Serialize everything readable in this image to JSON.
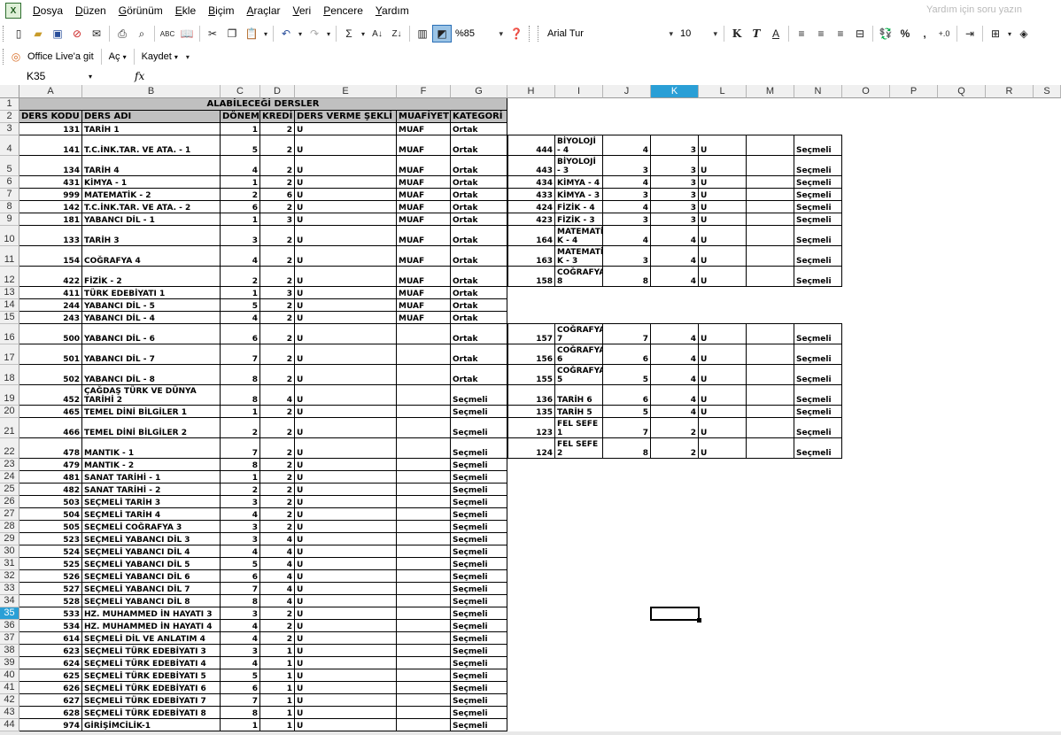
{
  "menu": {
    "items": [
      {
        "u": "D",
        "rest": "osya"
      },
      {
        "u": "D",
        "rest": "üzen"
      },
      {
        "u": "G",
        "rest": "örünüm"
      },
      {
        "u": "E",
        "rest": "kle"
      },
      {
        "u": "B",
        "rest": "içim"
      },
      {
        "u": "A",
        "rest": "raçlar"
      },
      {
        "u": "V",
        "rest": "eri"
      },
      {
        "u": "P",
        "rest": "encere"
      },
      {
        "u": "Y",
        "rest": "ardım"
      }
    ],
    "help_placeholder": "Yardım için soru yazın"
  },
  "toolbar": {
    "zoom": "%85",
    "font": "Arial Tur",
    "size": "10",
    "bold": "K",
    "italic": "T",
    "underline": "A",
    "percent": "%",
    "comma": ","
  },
  "toolbar2": {
    "office_live": "Office Live'a git",
    "open": "Aç",
    "save": "Kaydet"
  },
  "formula": {
    "namebox": "K35",
    "fx": "fx",
    "content": ""
  },
  "sheet": {
    "selected_cell": "K35",
    "columns": [
      "A",
      "B",
      "C",
      "D",
      "E",
      "F",
      "G",
      "H",
      "I",
      "J",
      "K",
      "L",
      "M",
      "N",
      "O",
      "P",
      "Q",
      "R",
      "S"
    ],
    "title": "ALABİLECEĞİ DERSLER",
    "headers": [
      "DERS KODU",
      "DERS ADI",
      "DÖNEM",
      "KREDİ",
      "DERS VERME ŞEKLİ",
      "MUAFİYET",
      "KATEGORİ"
    ],
    "rows": [
      {
        "r": "3",
        "a": "131",
        "b": "TARİH 1",
        "c": "1",
        "d": "2",
        "e": "U",
        "f": "MUAF",
        "g": "Ortak"
      },
      {
        "r": "4",
        "a": "141",
        "b": "T.C.İNK.TAR. VE ATA. - 1",
        "c": "5",
        "d": "2",
        "e": "U",
        "f": "MUAF",
        "g": "Ortak",
        "h": "444",
        "i": "BİYOLOJİ - 4",
        "j": "4",
        "k": "3",
        "l": "U",
        "n": "Seçmeli"
      },
      {
        "r": "5",
        "a": "134",
        "b": "TARİH 4",
        "c": "4",
        "d": "2",
        "e": "U",
        "f": "MUAF",
        "g": "Ortak",
        "h": "443",
        "i": "BİYOLOJİ - 3",
        "j": "3",
        "k": "3",
        "l": "U",
        "n": "Seçmeli"
      },
      {
        "r": "6",
        "a": "431",
        "b": "KİMYA - 1",
        "c": "1",
        "d": "2",
        "e": "U",
        "f": "MUAF",
        "g": "Ortak",
        "h": "434",
        "i": "KİMYA - 4",
        "j": "4",
        "k": "3",
        "l": "U",
        "n": "Seçmeli"
      },
      {
        "r": "7",
        "a": "999",
        "b": "MATEMATİK - 2",
        "c": "2",
        "d": "6",
        "e": "U",
        "f": "MUAF",
        "g": "Ortak",
        "h": "433",
        "i": "KİMYA - 3",
        "j": "3",
        "k": "3",
        "l": "U",
        "n": "Seçmeli"
      },
      {
        "r": "8",
        "a": "142",
        "b": "T.C.İNK.TAR. VE ATA. - 2",
        "c": "6",
        "d": "2",
        "e": "U",
        "f": "MUAF",
        "g": "Ortak",
        "h": "424",
        "i": "FİZİK - 4",
        "j": "4",
        "k": "3",
        "l": "U",
        "n": "Seçmeli"
      },
      {
        "r": "9",
        "a": "181",
        "b": "YABANCI DİL - 1",
        "c": "1",
        "d": "3",
        "e": "U",
        "f": "MUAF",
        "g": "Ortak",
        "h": "423",
        "i": "FİZİK - 3",
        "j": "3",
        "k": "3",
        "l": "U",
        "n": "Seçmeli"
      },
      {
        "r": "10",
        "a": "133",
        "b": "TARİH 3",
        "c": "3",
        "d": "2",
        "e": "U",
        "f": "MUAF",
        "g": "Ortak",
        "h": "164",
        "i": "MATEMATİ K - 4",
        "j": "4",
        "k": "4",
        "l": "U",
        "n": "Seçmeli"
      },
      {
        "r": "11",
        "a": "154",
        "b": "COĞRAFYA 4",
        "c": "4",
        "d": "2",
        "e": "U",
        "f": "MUAF",
        "g": "Ortak",
        "h": "163",
        "i": "MATEMATİ K - 3",
        "j": "3",
        "k": "4",
        "l": "U",
        "n": "Seçmeli"
      },
      {
        "r": "12",
        "a": "422",
        "b": "FİZİK - 2",
        "c": "2",
        "d": "2",
        "e": "U",
        "f": "MUAF",
        "g": "Ortak",
        "h": "158",
        "i": "COĞRAFYA 8",
        "j": "8",
        "k": "4",
        "l": "U",
        "n": "Seçmeli"
      },
      {
        "r": "13",
        "a": "411",
        "b": "TÜRK EDEBİYATI 1",
        "c": "1",
        "d": "3",
        "e": "U",
        "f": "MUAF",
        "g": "Ortak"
      },
      {
        "r": "14",
        "a": "244",
        "b": "YABANCI DİL - 5",
        "c": "5",
        "d": "2",
        "e": "U",
        "f": "MUAF",
        "g": "Ortak"
      },
      {
        "r": "15",
        "a": "243",
        "b": "YABANCI DİL - 4",
        "c": "4",
        "d": "2",
        "e": "U",
        "f": "MUAF",
        "g": "Ortak"
      },
      {
        "r": "16",
        "a": "500",
        "b": "YABANCI DİL - 6",
        "c": "6",
        "d": "2",
        "e": "U",
        "f": "",
        "g": "Ortak",
        "h": "157",
        "i": "COĞRAFYA 7",
        "j": "7",
        "k": "4",
        "l": "U",
        "n": "Seçmeli"
      },
      {
        "r": "17",
        "a": "501",
        "b": "YABANCI DİL - 7",
        "c": "7",
        "d": "2",
        "e": "U",
        "f": "",
        "g": "Ortak",
        "h": "156",
        "i": "COĞRAFYA 6",
        "j": "6",
        "k": "4",
        "l": "U",
        "n": "Seçmeli"
      },
      {
        "r": "18",
        "a": "502",
        "b": "YABANCI DİL - 8",
        "c": "8",
        "d": "2",
        "e": "U",
        "f": "",
        "g": "Ortak",
        "h": "155",
        "i": "COĞRAFYA 5",
        "j": "5",
        "k": "4",
        "l": "U",
        "n": "Seçmeli"
      },
      {
        "r": "19",
        "a": "452",
        "b": "ÇAĞDAŞ TÜRK VE DÜNYA TARİHİ 2",
        "c": "8",
        "d": "4",
        "e": "U",
        "f": "",
        "g": "Seçmeli",
        "h": "136",
        "i": "TARİH 6",
        "j": "6",
        "k": "4",
        "l": "U",
        "n": "Seçmeli"
      },
      {
        "r": "20",
        "a": "465",
        "b": "TEMEL DİNİ BİLGİLER 1",
        "c": "1",
        "d": "2",
        "e": "U",
        "f": "",
        "g": "Seçmeli",
        "h": "135",
        "i": "TARİH 5",
        "j": "5",
        "k": "4",
        "l": "U",
        "n": "Seçmeli"
      },
      {
        "r": "21",
        "a": "466",
        "b": "TEMEL DİNİ BİLGİLER 2",
        "c": "2",
        "d": "2",
        "e": "U",
        "f": "",
        "g": "Seçmeli",
        "h": "123",
        "i": "FEL SEFE 1",
        "j": "7",
        "k": "2",
        "l": "U",
        "n": "Seçmeli"
      },
      {
        "r": "22",
        "a": "478",
        "b": "MANTIK - 1",
        "c": "7",
        "d": "2",
        "e": "U",
        "f": "",
        "g": "Seçmeli",
        "h": "124",
        "i": "FEL SEFE 2",
        "j": "8",
        "k": "2",
        "l": "U",
        "n": "Seçmeli"
      },
      {
        "r": "23",
        "a": "479",
        "b": "MANTIK - 2",
        "c": "8",
        "d": "2",
        "e": "U",
        "f": "",
        "g": "Seçmeli"
      },
      {
        "r": "24",
        "a": "481",
        "b": "SANAT TARİHİ - 1",
        "c": "1",
        "d": "2",
        "e": "U",
        "f": "",
        "g": "Seçmeli"
      },
      {
        "r": "25",
        "a": "482",
        "b": "SANAT TARİHİ - 2",
        "c": "2",
        "d": "2",
        "e": "U",
        "f": "",
        "g": "Seçmeli"
      },
      {
        "r": "26",
        "a": "503",
        "b": "SEÇMELİ TARİH 3",
        "c": "3",
        "d": "2",
        "e": "U",
        "f": "",
        "g": "Seçmeli"
      },
      {
        "r": "27",
        "a": "504",
        "b": "SEÇMELİ TARİH 4",
        "c": "4",
        "d": "2",
        "e": "U",
        "f": "",
        "g": "Seçmeli"
      },
      {
        "r": "28",
        "a": "505",
        "b": "SEÇMELİ COĞRAFYA 3",
        "c": "3",
        "d": "2",
        "e": "U",
        "f": "",
        "g": "Seçmeli"
      },
      {
        "r": "29",
        "a": "523",
        "b": "SEÇMELİ YABANCI DİL 3",
        "c": "3",
        "d": "4",
        "e": "U",
        "f": "",
        "g": "Seçmeli"
      },
      {
        "r": "30",
        "a": "524",
        "b": "SEÇMELİ YABANCI DİL 4",
        "c": "4",
        "d": "4",
        "e": "U",
        "f": "",
        "g": "Seçmeli"
      },
      {
        "r": "31",
        "a": "525",
        "b": "SEÇMELİ YABANCI DİL 5",
        "c": "5",
        "d": "4",
        "e": "U",
        "f": "",
        "g": "Seçmeli"
      },
      {
        "r": "32",
        "a": "526",
        "b": "SEÇMELİ YABANCI DİL 6",
        "c": "6",
        "d": "4",
        "e": "U",
        "f": "",
        "g": "Seçmeli"
      },
      {
        "r": "33",
        "a": "527",
        "b": "SEÇMELİ YABANCI DİL 7",
        "c": "7",
        "d": "4",
        "e": "U",
        "f": "",
        "g": "Seçmeli"
      },
      {
        "r": "34",
        "a": "528",
        "b": "SEÇMELİ YABANCI DİL 8",
        "c": "8",
        "d": "4",
        "e": "U",
        "f": "",
        "g": "Seçmeli"
      },
      {
        "r": "35",
        "a": "533",
        "b": "HZ. MUHAMMED İN HAYATI 3",
        "c": "3",
        "d": "2",
        "e": "U",
        "f": "",
        "g": "Seçmeli"
      },
      {
        "r": "36",
        "a": "534",
        "b": "HZ. MUHAMMED İN HAYATI 4",
        "c": "4",
        "d": "2",
        "e": "U",
        "f": "",
        "g": "Seçmeli"
      },
      {
        "r": "37",
        "a": "614",
        "b": "SEÇMELİ DİL VE ANLATIM 4",
        "c": "4",
        "d": "2",
        "e": "U",
        "f": "",
        "g": "Seçmeli"
      },
      {
        "r": "38",
        "a": "623",
        "b": "SEÇMELİ TÜRK EDEBİYATI 3",
        "c": "3",
        "d": "1",
        "e": "U",
        "f": "",
        "g": "Seçmeli"
      },
      {
        "r": "39",
        "a": "624",
        "b": "SEÇMELİ TÜRK EDEBİYATI 4",
        "c": "4",
        "d": "1",
        "e": "U",
        "f": "",
        "g": "Seçmeli"
      },
      {
        "r": "40",
        "a": "625",
        "b": "SEÇMELİ TÜRK EDEBİYATI 5",
        "c": "5",
        "d": "1",
        "e": "U",
        "f": "",
        "g": "Seçmeli"
      },
      {
        "r": "41",
        "a": "626",
        "b": "SEÇMELİ TÜRK EDEBİYATI 6",
        "c": "6",
        "d": "1",
        "e": "U",
        "f": "",
        "g": "Seçmeli"
      },
      {
        "r": "42",
        "a": "627",
        "b": "SEÇMELİ TÜRK EDEBİYATI 7",
        "c": "7",
        "d": "1",
        "e": "U",
        "f": "",
        "g": "Seçmeli"
      },
      {
        "r": "43",
        "a": "628",
        "b": "SEÇMELİ TÜRK EDEBİYATI 8",
        "c": "8",
        "d": "1",
        "e": "U",
        "f": "",
        "g": "Seçmeli"
      },
      {
        "r": "44",
        "a": "974",
        "b": "GİRİŞİMCİLİK-1",
        "c": "1",
        "d": "1",
        "e": "U",
        "f": "",
        "g": "Seçmeli"
      }
    ]
  },
  "colors": {
    "selected_header": "#2a9fd6",
    "table_header_fill": "#c0c0c0",
    "grid_header_fill": "#f0f0f0"
  }
}
